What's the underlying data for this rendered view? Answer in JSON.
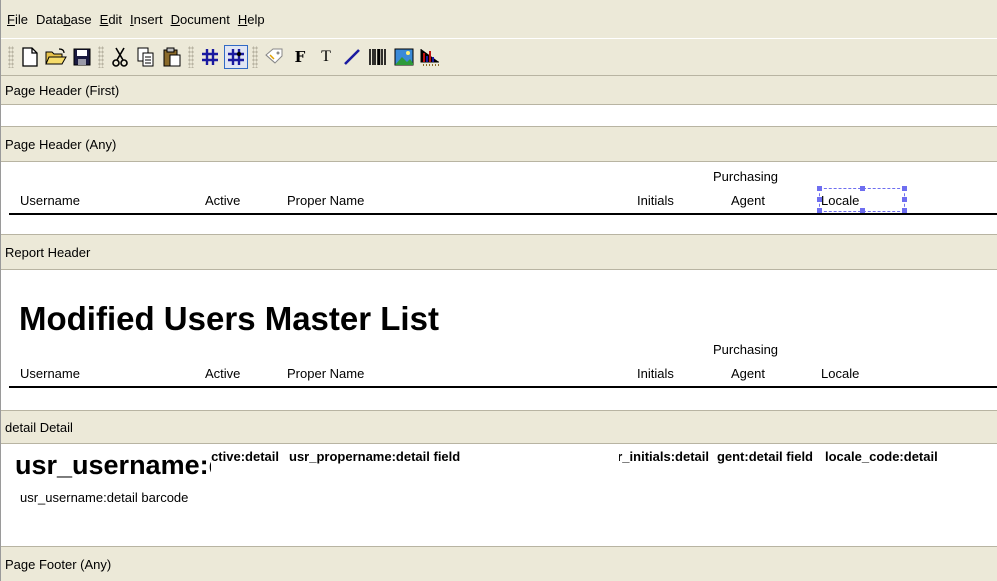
{
  "menu": [
    {
      "pre": "",
      "mn": "F",
      "post": "ile"
    },
    {
      "pre": "Data",
      "mn": "b",
      "post": "ase"
    },
    {
      "pre": "",
      "mn": "E",
      "post": "dit"
    },
    {
      "pre": "",
      "mn": "I",
      "post": "nsert"
    },
    {
      "pre": "",
      "mn": "D",
      "post": "ocument"
    },
    {
      "pre": "",
      "mn": "H",
      "post": "elp"
    }
  ],
  "toolbar": {
    "buttons": [
      "new-document-icon",
      "open-folder-icon",
      "save-icon",
      "cut-icon",
      "copy-icon",
      "paste-icon",
      "grid-icon",
      "snap-to-grid-icon",
      "label-tool-icon",
      "field-tool-icon",
      "text-tool-icon",
      "line-tool-icon",
      "barcode-tool-icon",
      "image-tool-icon",
      "chart-tool-icon"
    ],
    "field_glyph": "F",
    "text_glyph": "T"
  },
  "sections": {
    "page_header_first": "Page Header (First)",
    "page_header_any": "Page Header (Any)",
    "report_header": "Report Header",
    "detail": "detail Detail",
    "page_footer_any": "Page Footer (Any)"
  },
  "columns": {
    "username": "Username",
    "active": "Active",
    "proper_name": "Proper Name",
    "initials": "Initials",
    "purchasing": "Purchasing",
    "agent": "Agent",
    "locale": "Locale"
  },
  "report_title": "Modified Users Master List",
  "detail": {
    "username_field": "usr_username:detail field",
    "active_field": "usr_active:detail",
    "propername_field": "usr_propername:detail field",
    "initials_field": "usr_initials:detail",
    "agent_field": "usr_agent:detail field",
    "locale_field": "locale_code:detail",
    "barcode": "usr_username:detail barcode"
  },
  "colors": {
    "chrome": "#ece9d8",
    "selection": "#6e6ef0",
    "toolbar_active": "#316ac5"
  }
}
